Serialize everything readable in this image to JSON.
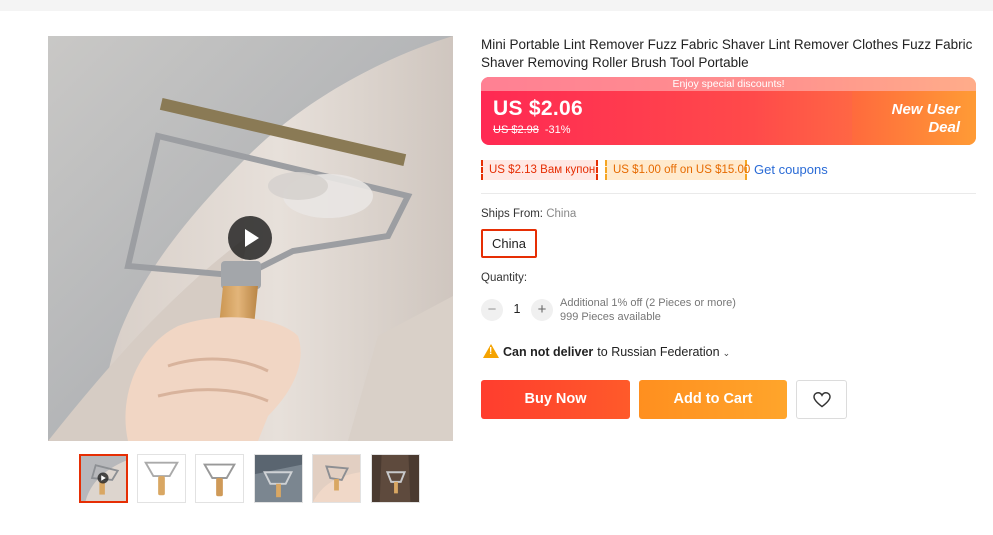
{
  "product": {
    "title": "Mini Portable Lint Remover Fuzz Fabric Shaver Lint Remover Clothes Fuzz Fabric Shaver Removing Roller Brush Tool Portable"
  },
  "price": {
    "discount_banner": "Enjoy special discounts!",
    "current": "US $2.06",
    "original": "US $2.98",
    "discount_pct": "-31%",
    "badge": "New User Deal",
    "colors": {
      "gradient_start": "#ff2953",
      "gradient_end": "#ff8a3d"
    }
  },
  "coupons": {
    "items": [
      "US $2.13 Вам купон",
      "US $1.00 off on US $15.00"
    ],
    "link": "Get coupons"
  },
  "shipping": {
    "label": "Ships From:",
    "value": "China",
    "option": "China"
  },
  "quantity": {
    "label": "Quantity:",
    "minus": "−",
    "plus": "+",
    "value": "1",
    "additional": "Additional 1% off (2 Pieces or more)",
    "available": "999 Pieces available"
  },
  "delivery": {
    "status": "Can not deliver",
    "destination": "to Russian Federation",
    "icon": "warning-icon"
  },
  "actions": {
    "buy_now": "Buy Now",
    "add_to_cart": "Add to Cart",
    "wishlist_icon": "heart-icon"
  },
  "gallery": {
    "thumbnail_count": 6,
    "selected_index": 0,
    "play_icon": "play-icon"
  }
}
